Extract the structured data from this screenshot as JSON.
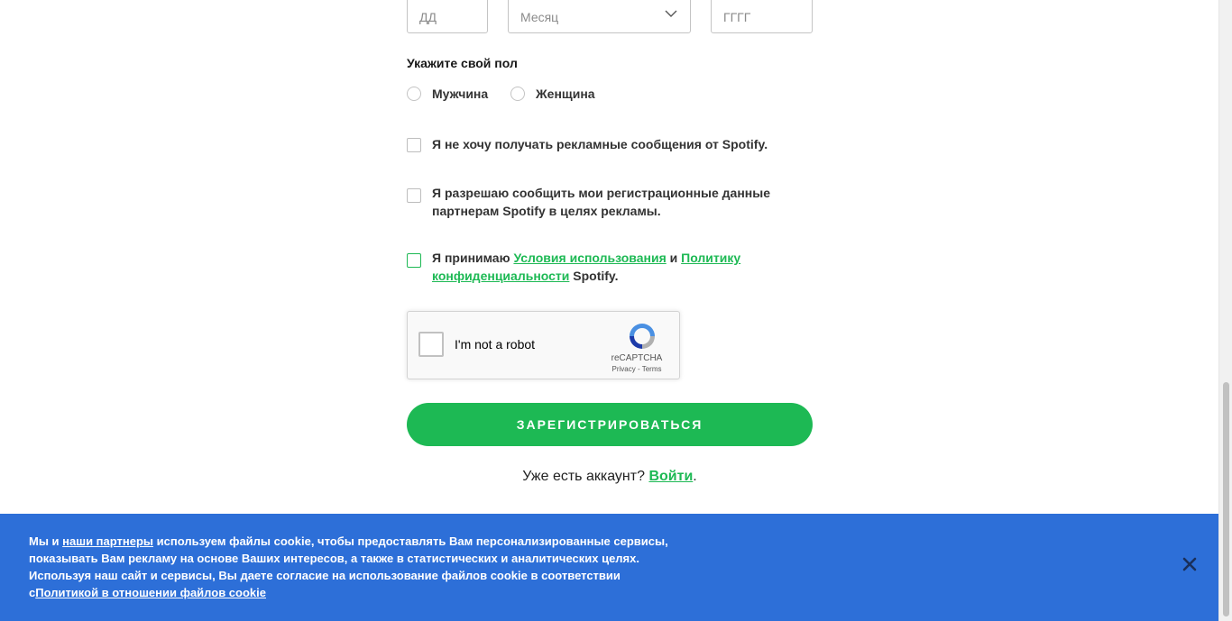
{
  "birthdate": {
    "day_placeholder": "ДД",
    "month_placeholder": "Месяц",
    "year_placeholder": "ГГГГ"
  },
  "gender": {
    "heading": "Укажите свой пол",
    "male": "Мужчина",
    "female": "Женщина"
  },
  "consents": {
    "no_marketing": "Я не хочу получать рекламные сообщения от Spotify.",
    "share_data": "Я разрешаю сообщить мои регистрационные данные партнерам Spotify в целях рекламы.",
    "terms_prefix": "Я принимаю ",
    "terms_link": "Условия использования",
    "terms_and": " и ",
    "privacy_link": "Политику конфиденциальности",
    "terms_suffix": " Spotify."
  },
  "captcha": {
    "label": "I'm not a robot",
    "brand": "reCAPTCHA",
    "links": "Privacy - Terms"
  },
  "signup_button": "ЗАРЕГИСТРИРОВАТЬСЯ",
  "login": {
    "prompt": "Уже есть аккаунт? ",
    "link": "Войти",
    "suffix": "."
  },
  "cookie_banner": {
    "text_1": "Мы и ",
    "partners_link": "наши партнеры",
    "text_2": " используем файлы cookie, чтобы предоставлять Вам персонализированные сервисы, показывать Вам рекламу на основе Ваших интересов, а также в статистических и аналитических целях. Используя наш сайт и сервисы, Вы даете согласие на использование файлов cookie в соответствии с",
    "policy_link": "Политикой в отношении файлов cookie",
    "background_color": "#2d6fd8"
  },
  "colors": {
    "accent": "#1db954"
  }
}
